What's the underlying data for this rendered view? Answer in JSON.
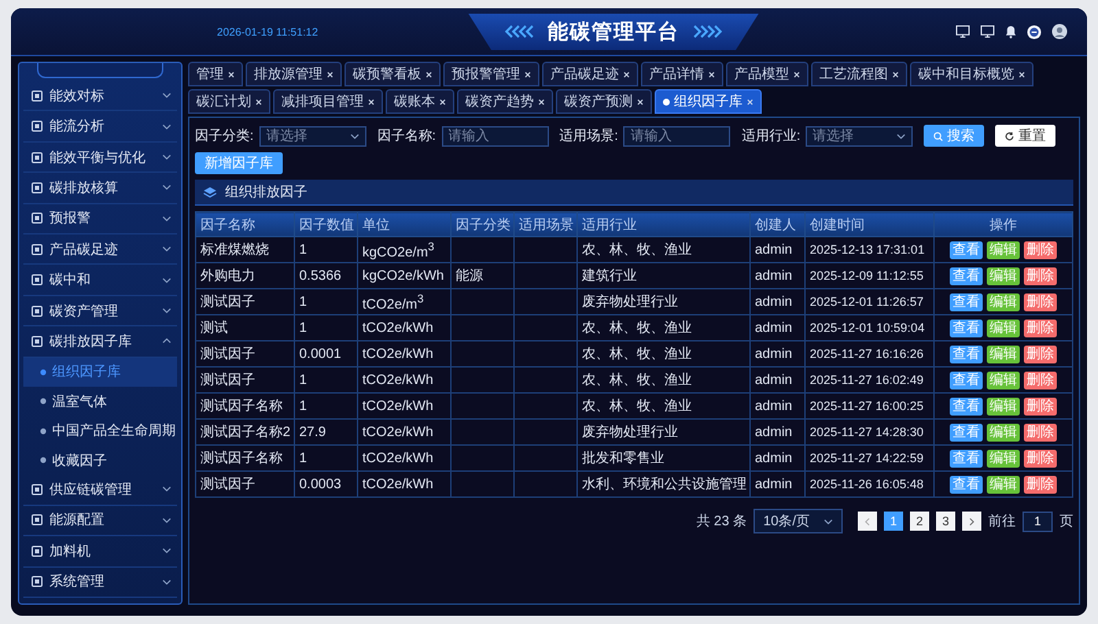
{
  "header": {
    "datetime": "2026-01-19 11:51:12",
    "title": "能碳管理平台"
  },
  "sidebar": {
    "items": [
      {
        "label": "能效对标",
        "expanded": false
      },
      {
        "label": "能流分析",
        "expanded": false
      },
      {
        "label": "能效平衡与优化",
        "expanded": false
      },
      {
        "label": "碳排放核算",
        "expanded": false
      },
      {
        "label": "预报警",
        "expanded": false
      },
      {
        "label": "产品碳足迹",
        "expanded": false
      },
      {
        "label": "碳中和",
        "expanded": false
      },
      {
        "label": "碳资产管理",
        "expanded": false
      },
      {
        "label": "碳排放因子库",
        "expanded": true,
        "children": [
          {
            "label": "组织因子库",
            "selected": true
          },
          {
            "label": "温室气体",
            "selected": false
          },
          {
            "label": "中国产品全生命周期",
            "selected": false
          },
          {
            "label": "收藏因子",
            "selected": false
          }
        ]
      },
      {
        "label": "供应链碳管理",
        "expanded": false
      },
      {
        "label": "能源配置",
        "expanded": false
      },
      {
        "label": "加料机",
        "expanded": false
      },
      {
        "label": "系统管理",
        "expanded": false
      }
    ]
  },
  "tabs": [
    {
      "label": "管理",
      "selected": false
    },
    {
      "label": "排放源管理",
      "selected": false
    },
    {
      "label": "碳预警看板",
      "selected": false
    },
    {
      "label": "预报警管理",
      "selected": false
    },
    {
      "label": "产品碳足迹",
      "selected": false
    },
    {
      "label": "产品详情",
      "selected": false
    },
    {
      "label": "产品模型",
      "selected": false
    },
    {
      "label": "工艺流程图",
      "selected": false
    },
    {
      "label": "碳中和目标概览",
      "selected": false
    },
    {
      "label": "碳汇计划",
      "selected": false
    },
    {
      "label": "减排项目管理",
      "selected": false
    },
    {
      "label": "碳账本",
      "selected": false
    },
    {
      "label": "碳资产趋势",
      "selected": false
    },
    {
      "label": "碳资产预测",
      "selected": false
    },
    {
      "label": "组织因子库",
      "selected": true
    }
  ],
  "filters": [
    {
      "label": "因子分类:",
      "kind": "select",
      "placeholder": "请选择"
    },
    {
      "label": "因子名称:",
      "kind": "input",
      "placeholder": "请输入"
    },
    {
      "label": "适用场景:",
      "kind": "input",
      "placeholder": "请输入"
    },
    {
      "label": "适用行业:",
      "kind": "select",
      "placeholder": "请选择"
    }
  ],
  "search_button": "搜索",
  "reset_button": "重置",
  "add_button": "新增因子库",
  "section_title": "组织排放因子",
  "table": {
    "columns": [
      "因子名称",
      "因子数值",
      "单位",
      "因子分类",
      "适用场景",
      "适用行业",
      "创建人",
      "创建时间",
      "操作"
    ],
    "rows": [
      {
        "name": "标准煤燃烧",
        "value": "1",
        "unit": "kgCO2e/m$^{3}$",
        "industry": "农、林、牧、渔业",
        "creator": "admin",
        "created": "2025-12-13 17:31:01",
        "actions": [
          {
            "label": "查看",
            "kind": "view"
          },
          {
            "label": "编辑",
            "kind": "edit"
          },
          {
            "label": "删除",
            "kind": "delete"
          }
        ]
      },
      {
        "name": "外购电力",
        "value": "0.5366",
        "unit": "kgCO2e/kWh",
        "category": "能源",
        "industry": "建筑行业",
        "creator": "admin",
        "created": "2025-12-09 11:12:55",
        "actions": [
          {
            "label": "查看",
            "kind": "view"
          },
          {
            "label": "编辑",
            "kind": "edit"
          },
          {
            "label": "删除",
            "kind": "delete"
          }
        ]
      },
      {
        "name": "测试因子",
        "value": "1",
        "unit": "tCO2e/m$^{3}$",
        "industry": "废弃物处理行业",
        "creator": "admin",
        "created": "2025-12-01 11:26:57",
        "actions": [
          {
            "label": "查看",
            "kind": "view"
          },
          {
            "label": "编辑",
            "kind": "edit"
          },
          {
            "label": "删除",
            "kind": "delete"
          }
        ]
      },
      {
        "name": "测试",
        "value": "1",
        "unit": "tCO2e/kWh",
        "industry": "农、林、牧、渔业",
        "creator": "admin",
        "created": "2025-12-01 10:59:04",
        "actions": [
          {
            "label": "查看",
            "kind": "view"
          },
          {
            "label": "编辑",
            "kind": "edit"
          },
          {
            "label": "删除",
            "kind": "delete"
          }
        ]
      },
      {
        "name": "测试因子",
        "value": "0.0001",
        "unit": "tCO2e/kWh",
        "industry": "农、林、牧、渔业",
        "creator": "admin",
        "created": "2025-11-27 16:16:26",
        "actions": [
          {
            "label": "查看",
            "kind": "view"
          },
          {
            "label": "编辑",
            "kind": "edit"
          },
          {
            "label": "删除",
            "kind": "delete"
          }
        ]
      },
      {
        "name": "测试因子",
        "value": "1",
        "unit": "tCO2e/kWh",
        "industry": "农、林、牧、渔业",
        "creator": "admin",
        "created": "2025-11-27 16:02:49",
        "actions": [
          {
            "label": "查看",
            "kind": "view"
          },
          {
            "label": "编辑",
            "kind": "edit"
          },
          {
            "label": "删除",
            "kind": "delete"
          }
        ]
      },
      {
        "name": "测试因子名称",
        "value": "1",
        "unit": "tCO2e/kWh",
        "industry": "农、林、牧、渔业",
        "creator": "admin",
        "created": "2025-11-27 16:00:25",
        "actions": [
          {
            "label": "查看",
            "kind": "view"
          },
          {
            "label": "编辑",
            "kind": "edit"
          },
          {
            "label": "删除",
            "kind": "delete"
          }
        ]
      },
      {
        "name": "测试因子名称2",
        "value": "27.9",
        "unit": "tCO2e/kWh",
        "industry": "废弃物处理行业",
        "creator": "admin",
        "created": "2025-11-27 14:28:30",
        "actions": [
          {
            "label": "查看",
            "kind": "view"
          },
          {
            "label": "编辑",
            "kind": "edit"
          },
          {
            "label": "删除",
            "kind": "delete"
          }
        ]
      },
      {
        "name": "测试因子名称",
        "value": "1",
        "unit": "tCO2e/kWh",
        "industry": "批发和零售业",
        "creator": "admin",
        "created": "2025-11-27 14:22:59",
        "actions": [
          {
            "label": "查看",
            "kind": "view"
          },
          {
            "label": "编辑",
            "kind": "edit"
          },
          {
            "label": "删除",
            "kind": "delete"
          }
        ]
      },
      {
        "name": "测试因子",
        "value": "0.0003",
        "unit": "tCO2e/kWh",
        "industry": "水利、环境和公共设施管理",
        "creator": "admin",
        "created": "2025-11-26 16:05:48",
        "actions": [
          {
            "label": "查看",
            "kind": "view"
          },
          {
            "label": "编辑",
            "kind": "edit"
          },
          {
            "label": "删除",
            "kind": "delete"
          }
        ]
      }
    ]
  },
  "pagination": {
    "total": "共 23 条",
    "page_size": "10条/页",
    "pages": [
      {
        "label": "1",
        "selected": true
      },
      {
        "label": "2",
        "selected": false
      },
      {
        "label": "3",
        "selected": false
      }
    ],
    "goto_label": "前往",
    "goto_value": "1",
    "goto_suffix": "页"
  }
}
